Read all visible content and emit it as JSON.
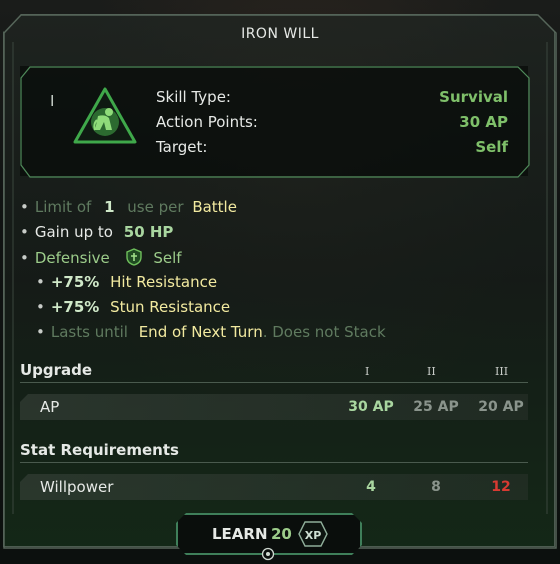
{
  "title": "IRON WILL",
  "skill": {
    "tier": "I",
    "icon": "kneeling-figure-icon",
    "props": [
      {
        "label": "Skill Type:",
        "value": "Survival"
      },
      {
        "label": "Action Points:",
        "value": "30 AP"
      },
      {
        "label": "Target:",
        "value": "Self"
      }
    ]
  },
  "effects": {
    "limit_prefix": "Limit of",
    "limit_num": "1",
    "limit_mid": "use per",
    "limit_scope": "Battle",
    "gain_prefix": "Gain up to",
    "gain_value": "50 HP",
    "defensive_label": "Defensive",
    "defensive_icon": "shield-icon",
    "defensive_target": "Self",
    "hit_value": "+75%",
    "hit_label": "Hit Resistance",
    "stun_value": "+75%",
    "stun_label": "Stun Resistance",
    "lasts_prefix": "Lasts until",
    "lasts_value": "End of Next Turn",
    "lasts_suffix": ". Does not Stack"
  },
  "upgrade": {
    "heading": "Upgrade",
    "tiers": [
      "I",
      "II",
      "III"
    ],
    "row_label": "AP",
    "values": [
      "30 AP",
      "25 AP",
      "20 AP"
    ]
  },
  "requirements": {
    "heading": "Stat Requirements",
    "row_label": "Willpower",
    "values": [
      "4",
      "8",
      "12"
    ]
  },
  "learn": {
    "label": "LEARN",
    "cost": "20",
    "currency": "XP"
  },
  "colors": {
    "accent_green": "#7fc06a",
    "button_border": "#3f7f5a",
    "requirement_unmet": "#d83a32"
  }
}
